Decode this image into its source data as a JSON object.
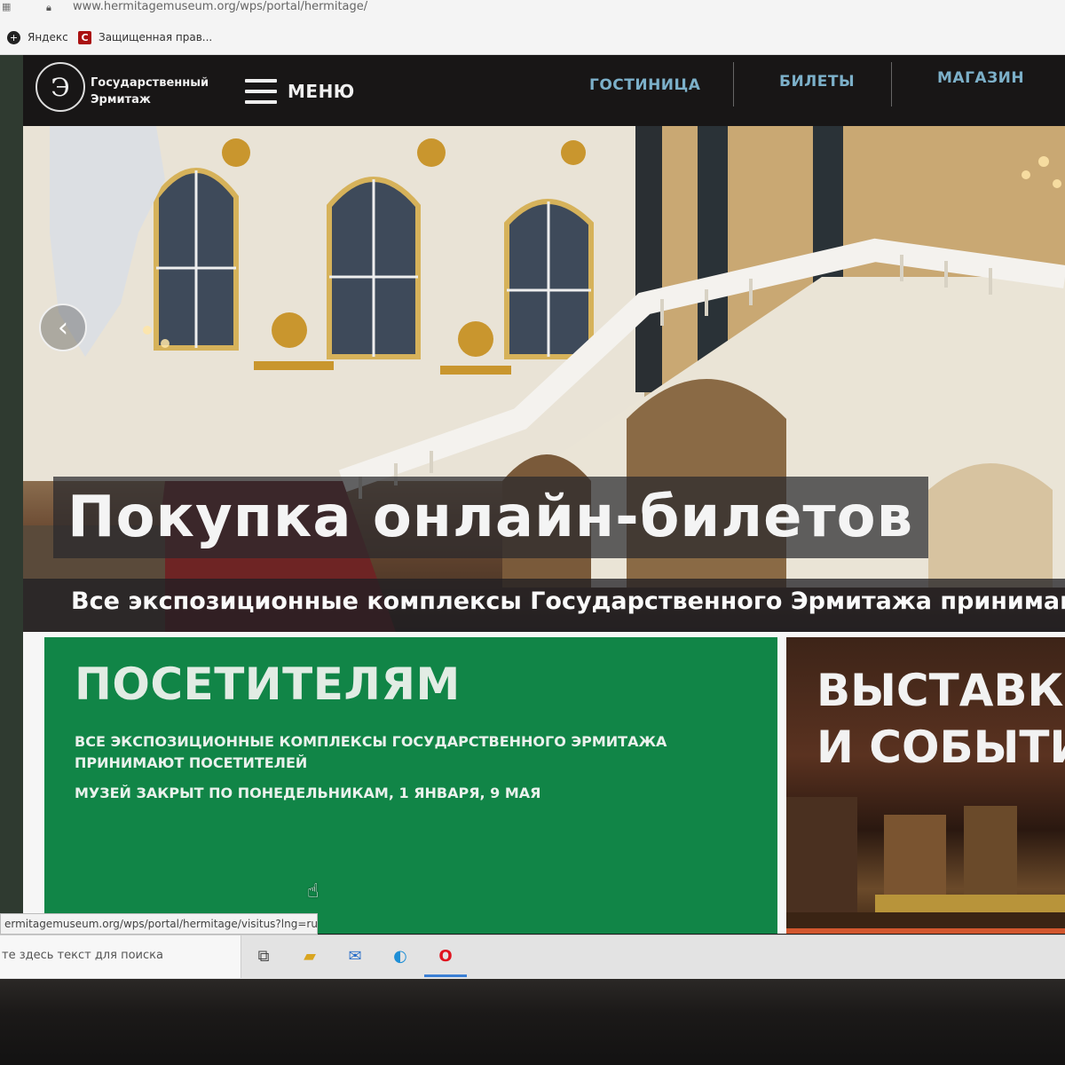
{
  "browser": {
    "url": "www.hermitagemuseum.org/wps/portal/hermitage/",
    "bookmarks": [
      {
        "label": "Яндекс"
      },
      {
        "label": "Защищенная прав..."
      }
    ]
  },
  "header": {
    "logo_text": "Государственный\nЭрмитаж",
    "menu_label": "МЕНЮ",
    "nav": [
      "ГОСТИНИЦА",
      "БИЛЕТЫ",
      "МАГАЗИН"
    ]
  },
  "hero": {
    "title": "Покупка онлайн-билетов",
    "subtitle": "Все экспозиционные комплексы Государственного Эрмитажа принимаю"
  },
  "cards": {
    "visitors": {
      "title": "ПОСЕТИТЕЛЯМ",
      "line1": "ВСЕ ЭКСПОЗИЦИОННЫЕ КОМПЛЕКСЫ ГОСУДАРСТВЕННОГО ЭРМИТАЖА ПРИНИМАЮТ ПОСЕТИТЕЛЕЙ",
      "line2": "МУЗЕЙ ЗАКРЫТ ПО ПОНЕДЕЛЬНИКАМ, 1 ЯНВАРЯ, 9 МАЯ"
    },
    "exhibitions": {
      "title": "ВЫСТАВК\nИ СОБЫТИ"
    }
  },
  "status_link": "ermitagemuseum.org/wps/portal/hermitage/visitus?lng=ru",
  "taskbar": {
    "search_placeholder": "те здесь текст для поиска",
    "icons": [
      "task-view-icon",
      "file-explorer-icon",
      "mail-icon",
      "edge-icon",
      "opera-icon"
    ]
  },
  "colors": {
    "header_bg": "#181616",
    "nav_link": "#7cb0c9",
    "visitors_green": "#118547",
    "exhibitions_accent": "#d2572e"
  }
}
